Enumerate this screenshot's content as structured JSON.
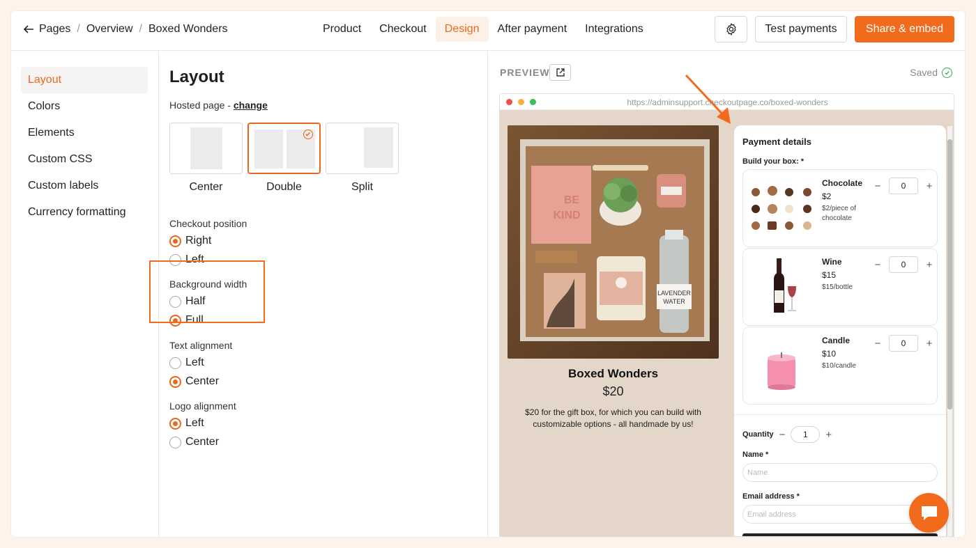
{
  "breadcrumb": {
    "items": [
      "Pages",
      "Overview",
      "Boxed Wonders"
    ]
  },
  "nav": {
    "tabs": [
      {
        "label": "Product"
      },
      {
        "label": "Checkout"
      },
      {
        "label": "Design"
      },
      {
        "label": "After payment"
      },
      {
        "label": "Integrations"
      }
    ],
    "active": "Design"
  },
  "header": {
    "test_label": "Test payments",
    "share_label": "Share & embed"
  },
  "sidebar": {
    "items": [
      {
        "label": "Layout"
      },
      {
        "label": "Colors"
      },
      {
        "label": "Elements"
      },
      {
        "label": "Custom CSS"
      },
      {
        "label": "Custom labels"
      },
      {
        "label": "Currency formatting"
      }
    ],
    "active": "Layout"
  },
  "settings": {
    "title": "Layout",
    "hosted_prefix": "Hosted page - ",
    "hosted_link": "change",
    "layouts": [
      {
        "label": "Center"
      },
      {
        "label": "Double"
      },
      {
        "label": "Split"
      }
    ],
    "selected_layout": "Double",
    "checkout_position": {
      "label": "Checkout position",
      "options": [
        "Right",
        "Left"
      ],
      "selected": "Right"
    },
    "background_width": {
      "label": "Background width",
      "options": [
        "Half",
        "Full"
      ],
      "selected": "Full"
    },
    "text_alignment": {
      "label": "Text alignment",
      "options": [
        "Left",
        "Center"
      ],
      "selected": "Center"
    },
    "logo_alignment": {
      "label": "Logo alignment",
      "options": [
        "Left",
        "Center"
      ],
      "selected": "Left"
    }
  },
  "preview": {
    "label": "PREVIEW",
    "saved": "Saved",
    "url": "https://adminsupport.checkoutpage.co/boxed-wonders",
    "product": {
      "title": "Boxed Wonders",
      "price": "$20",
      "description": "$20 for the gift box, for which you can build with customizable options - all handmade by us!"
    },
    "payment": {
      "title": "Payment details",
      "build_label": "Build your box: *",
      "items": [
        {
          "name": "Chocolate",
          "price": "$2",
          "unit": "$2/piece of chocolate",
          "qty": "0"
        },
        {
          "name": "Wine",
          "price": "$15",
          "unit": "$15/bottle",
          "qty": "0"
        },
        {
          "name": "Candle",
          "price": "$10",
          "unit": "$10/candle",
          "qty": "0"
        }
      ],
      "quantity_label": "Quantity",
      "quantity_value": "1",
      "name_label": "Name *",
      "name_placeholder": "Name",
      "email_label": "Email address *",
      "email_placeholder": "Email address"
    }
  },
  "colors": {
    "accent": "#f26b1d",
    "active_text": "#ea6a1e",
    "canvas": "#e4d7ca"
  }
}
